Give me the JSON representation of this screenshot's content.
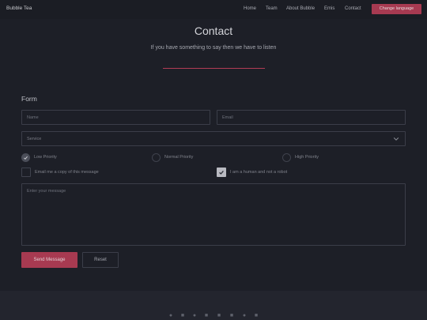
{
  "navbar": {
    "brand": "Bubble Tea",
    "links": [
      "Home",
      "Team",
      "About Bubble",
      "Emis",
      "Contact"
    ],
    "change_language": "Change language"
  },
  "header": {
    "title": "Contact",
    "subtitle": "If you have something to say then we have to listen"
  },
  "form": {
    "label": "Form",
    "name_placeholder": "Name",
    "email_placeholder": "Email",
    "service_value": "Service",
    "priorities": [
      {
        "label": "Low Priority",
        "checked": true
      },
      {
        "label": "Normal Priority",
        "checked": false
      },
      {
        "label": "High Priority",
        "checked": false
      }
    ],
    "copy_label": "Email me a copy of this message",
    "human_label": "I am a human and not a robot",
    "copy_checked": false,
    "human_checked": true,
    "message_placeholder": "Enter your message",
    "send_label": "Send Message",
    "reset_label": "Reset"
  },
  "footer": {
    "social_icons": [
      "github-icon",
      "twitter-icon",
      "facebook-icon",
      "instagram-icon",
      "linkedin-icon",
      "youtube-icon",
      "email-icon",
      "rss-icon"
    ]
  },
  "colors": {
    "accent": "#a73a51",
    "background": "#1d1f27"
  }
}
